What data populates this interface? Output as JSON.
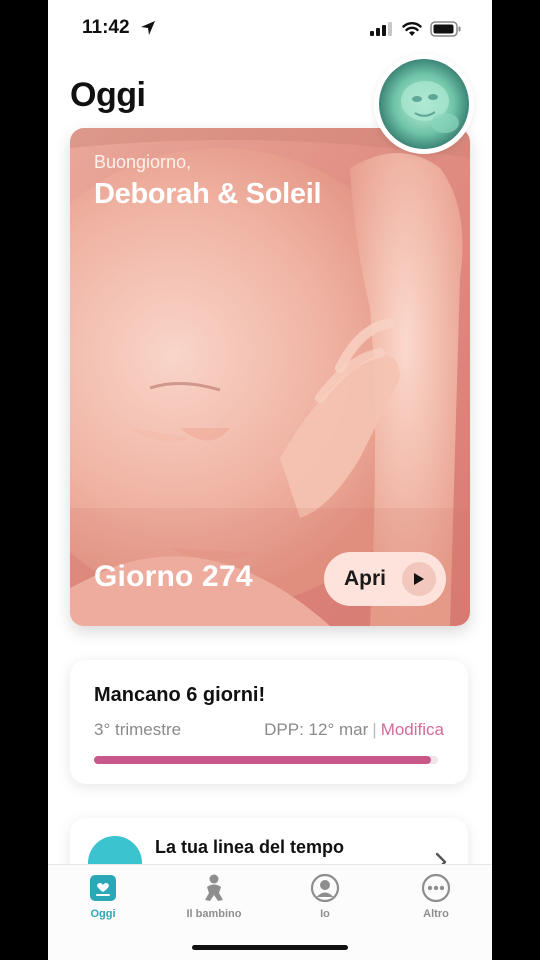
{
  "status_bar": {
    "time": "11:42"
  },
  "page": {
    "title": "Oggi"
  },
  "hero": {
    "greeting": "Buongiorno,",
    "names": "Deborah & Soleil",
    "day": "Giorno 274",
    "open_label": "Apri"
  },
  "countdown": {
    "title": "Mancano 6 giorni!",
    "trimester": "3° trimestre",
    "due_date": "DPP: 12° mar",
    "separator": "|",
    "edit_label": "Modifica",
    "progress": 0.98
  },
  "timeline": {
    "title": "La tua linea del tempo"
  },
  "tabs": [
    {
      "label": "Oggi",
      "icon": "today-icon",
      "active": true
    },
    {
      "label": "Il bambino",
      "icon": "baby-icon",
      "active": false
    },
    {
      "label": "Io",
      "icon": "profile-icon",
      "active": false
    },
    {
      "label": "Altro",
      "icon": "more-icon",
      "active": false
    }
  ],
  "colors": {
    "accent_teal": "#2aa8b8",
    "accent_pink": "#d36a9a",
    "progress_pink": "#c9588a"
  }
}
